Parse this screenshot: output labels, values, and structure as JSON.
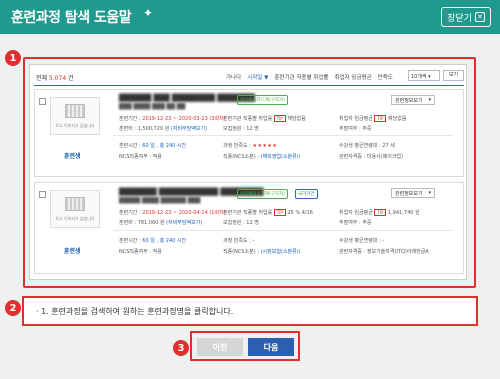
{
  "window": {
    "title": "훈련과정 탐색 도움말",
    "close_label": "창닫기"
  },
  "steps": [
    "1",
    "2",
    "3"
  ],
  "list": {
    "total_prefix": "전체 ",
    "total_count": "5,074",
    "total_suffix": " 건",
    "sort_options": [
      "가나다",
      "시작일 ▼",
      "훈련기관 직종별 취업률",
      "취업자 임금평균",
      "만족도"
    ],
    "page_size": "10개씩",
    "view_label": "보기"
  },
  "cards": [
    {
      "image_caption": "로고 이미지가 없습니다",
      "org_label": "훈련생",
      "name": "██████ ███ ████████ ███████",
      "sub": "███ ████ ███ ██ ██",
      "tags": [
        "내일배움카드제(구직자)"
      ],
      "info_button": "관련정보보기",
      "period_label": "훈련기간 : ",
      "period": "2019-12-23 ~ 2020-03-23 (3회차)",
      "employ_label": "훈련기관 직종별 취업률 ",
      "employ_value": "해당없음",
      "wage_label": "취업자 임금평균 ",
      "wage_value": "해당없음",
      "cost_label": "훈련비 : ",
      "cost": "1,500,720 원",
      "cost_extra": "(자비부담액보기)",
      "capacity_label": "모집정원 : ",
      "capacity": "12 명",
      "address_label": "주말여부 : ",
      "address": "주중",
      "hours_label": "훈련시간 : ",
      "hours": "60 일 , 총 240 시간",
      "satisfaction_label": "과정 만족도 : ",
      "satisfaction_stars": "★★★★★",
      "recruit_label": "수강생 평균연령대 : ",
      "recruit": "27 세",
      "ncs_label": "NCS직종여부 : ",
      "ncs": "적용",
      "job_label": "직종(NCS소분) : ",
      "job": "(해외영업(소분류))",
      "cert_label": "관련자격증 : ",
      "cert": "미용사(메이크업)"
    },
    {
      "image_caption": "로고 이미지가 없습니다",
      "org_label": "훈련생",
      "name": "███████ ███████████ ████████",
      "sub": "█████ ████ ██████ ███",
      "tags": [
        "내일배움카드제(구직자)",
        "국가기간"
      ],
      "info_button": "관련정보보기",
      "period_label": "훈련기간 : ",
      "period": "2019-12-23 ~ 2020-04-14 (1회차)",
      "employ_label": "훈련기관 직종별 취업률 ",
      "employ_value": "25 % 4/16",
      "wage_label": "취업자 임금평균 ",
      "wage_value": "1,941,740 원",
      "cost_label": "훈련비 : ",
      "cost": "781,060 원",
      "cost_extra": "(자비부담액보기)",
      "capacity_label": "모집정원 : ",
      "capacity": "12 명",
      "address_label": "주말여부 : ",
      "address": "주중",
      "hours_label": "훈련시간 : ",
      "hours": "60 일 , 총 240 시간",
      "satisfaction_label": "과정 만족도 : ",
      "satisfaction_stars": "-",
      "recruit_label": "수강생 평균연령대 : ",
      "recruit": "-",
      "ncs_label": "NCS직종여부 : ",
      "ncs": "적용",
      "job_label": "직종(NCS소분) : ",
      "job": "(시판보험(소분류))",
      "cert_label": "관련자격증 : ",
      "cert": "정보기술자격(ITQ)아래한글A"
    }
  ],
  "instruction": "· 1. 훈련과정을 검색하여 원하는 훈련과정명을 클릭합니다.",
  "buttons": {
    "prev": "이전",
    "next": "다음"
  },
  "colors": {
    "header": "#1f9a8e",
    "highlight": "#e02f2f",
    "primary_button": "#2b5fb0"
  }
}
